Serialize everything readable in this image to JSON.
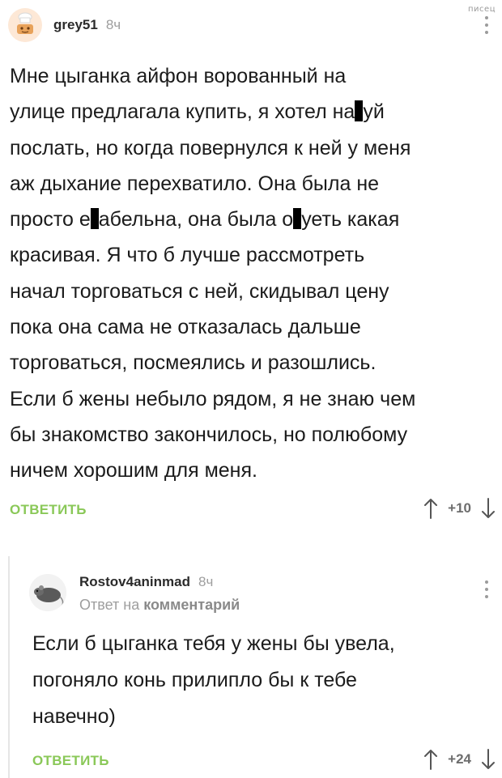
{
  "watermark": "писец",
  "comments": [
    {
      "username": "grey51",
      "time": "8ч",
      "text_parts": [
        "Мне цыганка айфон ворованный на\nулице предлагала купить, я хотел на",
        "уй\nпослать, но когда повернулся к ней у меня\nаж дыхание перехватило. Она была не\nпросто е",
        "абельна, она была о",
        "уеть какая\nкрасивая. Я что б лучше рассмотреть\nначал торговаться с ней, скидывал цену\nпока она сама не отказалась дальше\nторговаться, посмеялись и разошлись.\nЕсли б жены небыло рядом, я не знаю чем\nбы знакомство закончилось, но полюбому\nничем хорошим для меня."
      ],
      "reply_label": "ОТВЕТИТЬ",
      "rating": "+10"
    },
    {
      "username": "Rostov4aninmad",
      "time": "8ч",
      "reply_prefix": "Ответ на",
      "reply_target": "комментарий",
      "text": "Если б цыганка тебя у жены бы увела,\nпогоняло конь прилипло бы к тебе\nнавечно)",
      "reply_label": "ОТВЕТИТЬ",
      "rating": "+24"
    }
  ],
  "colors": {
    "accent_green": "#8ac858",
    "muted_text": "#9e9e9e",
    "censor_bar": "#000000"
  },
  "icons": [
    "chef-avatar-icon",
    "rat-avatar-icon",
    "more-menu-icon",
    "upvote-arrow-icon",
    "downvote-arrow-icon"
  ]
}
